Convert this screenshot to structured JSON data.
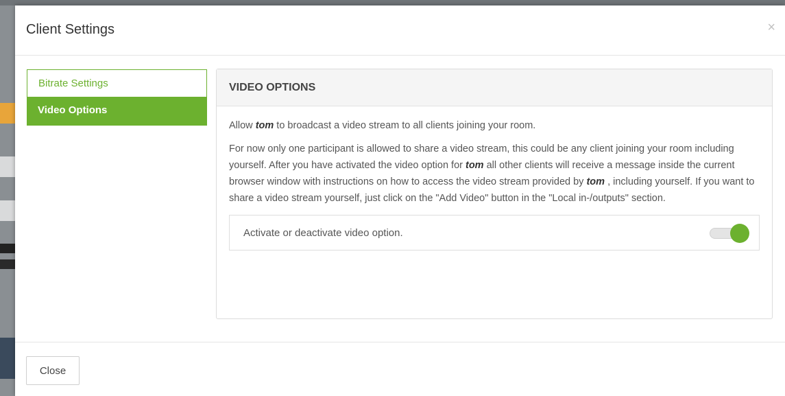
{
  "modal": {
    "title": "Client Settings",
    "close_icon": "×"
  },
  "sidebar": {
    "items": [
      {
        "label": "Bitrate Settings",
        "active": false
      },
      {
        "label": "Video Options",
        "active": true
      }
    ]
  },
  "panel": {
    "heading": "VIDEO OPTIONS",
    "intro": {
      "before": "Allow ",
      "user": "tom",
      "after": " to broadcast a video stream to all clients joining your room."
    },
    "details": {
      "part1": "For now only one participant is allowed to share a video stream, this could be any client joining your room including yourself. After you have activated the video option for ",
      "user1": "tom",
      "part2": " all other clients will receive a message inside the current browser window with instructions on how to access the video stream provided by ",
      "user2": "tom",
      "part3": " , including yourself. If you want to share a video stream yourself, just click on the \"Add Video\" button in the \"Local in-/outputs\" section."
    },
    "toggle": {
      "label": "Activate or deactivate video option.",
      "on": true
    }
  },
  "footer": {
    "close_label": "Close"
  },
  "colors": {
    "accent": "#6cb12f"
  }
}
